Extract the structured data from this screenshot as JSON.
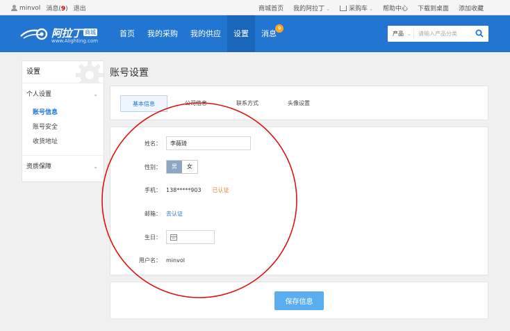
{
  "topbar": {
    "username": "minvol",
    "messages_label": "消息(",
    "messages_count": "9",
    "messages_close": ")",
    "logout": "退出",
    "links": {
      "mall_home": "商城首页",
      "my_alating": "我的阿拉丁",
      "cart": "采购车",
      "help": "帮助中心",
      "desktop": "下载到桌面",
      "favorite": "添加收藏"
    }
  },
  "header": {
    "brand": "阿拉丁",
    "brand_tag": "商城",
    "brand_url": "www.Alighting.com",
    "nav": {
      "home": "首页",
      "purchase": "我的采购",
      "supply": "我的供应",
      "settings": "设置",
      "messages": "消息",
      "messages_badge": "9"
    },
    "search": {
      "category": "产品",
      "placeholder": "请输入产品分类"
    }
  },
  "sidebar": {
    "title": "设置",
    "section_personal": "个人设置",
    "links": {
      "account_info": "账号信息",
      "account_security": "账号安全",
      "address": "收货地址"
    },
    "section_qualification": "资质保障"
  },
  "main": {
    "title": "账号设置",
    "tabs": {
      "basic": "基本信息",
      "company": "公司信息",
      "contact": "联系方式",
      "avatar": "头像设置"
    },
    "form": {
      "name_label": "姓名：",
      "name_value": "李薇琦",
      "gender_label": "性别：",
      "gender_male": "男",
      "gender_female": "女",
      "phone_label": "手机：",
      "phone_value": "138*****903",
      "phone_status": "已认证",
      "email_label": "邮箱：",
      "email_action": "去认证",
      "birthday_label": "生日：",
      "username_label": "用户名：",
      "username_value": "minvol"
    },
    "save_button": "保存信息"
  },
  "colors": {
    "header_blue": "#2276d2",
    "active_nav": "#1a66bb",
    "badge_orange": "#f6a623",
    "verified_orange": "#e7841e",
    "save_button": "#5aaef0",
    "annotation_red": "#e01010"
  },
  "icons": {
    "user": "user-icon",
    "cart": "cart-icon",
    "search": "search-icon",
    "gear": "gear-icon",
    "calendar": "calendar-icon"
  }
}
